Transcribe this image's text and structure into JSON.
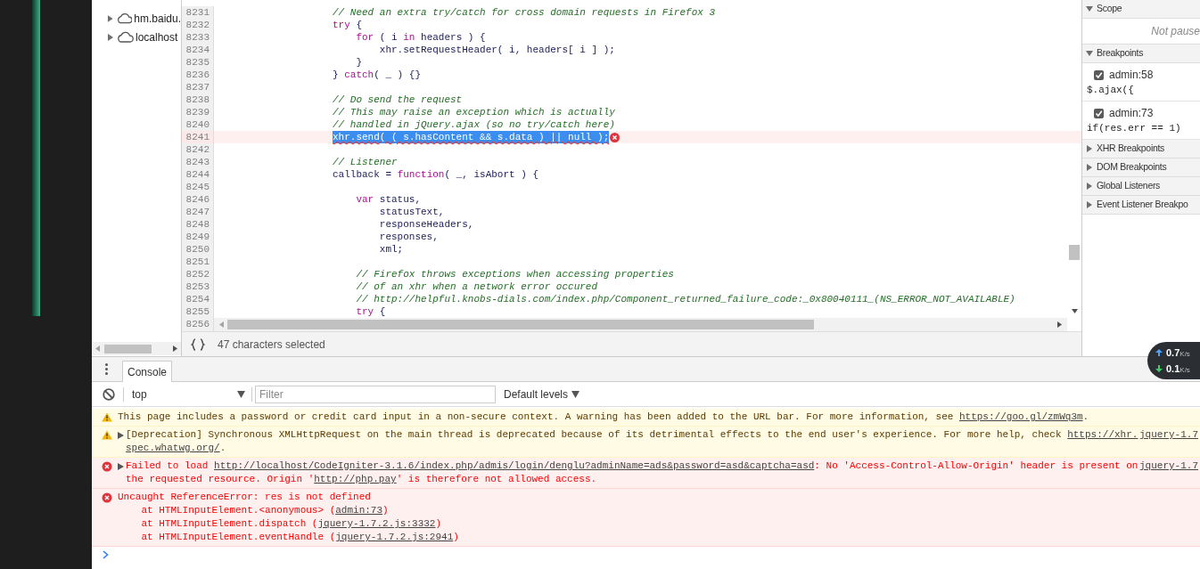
{
  "file_tree": {
    "items": [
      {
        "label": "hm.baidu.",
        "expanded": false
      },
      {
        "label": "localhost",
        "expanded": false
      }
    ]
  },
  "editor": {
    "lines": [
      {
        "number": "8231",
        "error": false,
        "selected": false,
        "segments": [
          {
            "kind": "comment",
            "text": "// Need an extra try/catch for cross domain requests in Firefox 3"
          }
        ]
      },
      {
        "number": "8232",
        "error": false,
        "selected": false,
        "segments": [
          {
            "kind": "keyword",
            "text": "try"
          },
          {
            "kind": "plain",
            "text": " {"
          }
        ]
      },
      {
        "number": "8233",
        "error": false,
        "selected": false,
        "segments": [
          {
            "kind": "keyword",
            "text": "    for"
          },
          {
            "kind": "plain",
            "text": " ( i "
          },
          {
            "kind": "keyword",
            "text": "in"
          },
          {
            "kind": "plain",
            "text": " headers ) {"
          }
        ]
      },
      {
        "number": "8234",
        "error": false,
        "selected": false,
        "segments": [
          {
            "kind": "plain",
            "text": "        xhr.setRequestHeader( i, headers[ i ] );"
          }
        ]
      },
      {
        "number": "8235",
        "error": false,
        "selected": false,
        "segments": [
          {
            "kind": "plain",
            "text": "    }"
          }
        ]
      },
      {
        "number": "8236",
        "error": false,
        "selected": false,
        "segments": [
          {
            "kind": "plain",
            "text": "} "
          },
          {
            "kind": "keyword",
            "text": "catch"
          },
          {
            "kind": "plain",
            "text": "( _ ) {}"
          }
        ]
      },
      {
        "number": "8237",
        "error": false,
        "selected": false
      },
      {
        "number": "8238",
        "error": false,
        "selected": false,
        "segments": [
          {
            "kind": "comment",
            "text": "// Do send the request"
          }
        ]
      },
      {
        "number": "8239",
        "error": false,
        "selected": false,
        "segments": [
          {
            "kind": "comment",
            "text": "// This may raise an exception which is actually"
          }
        ]
      },
      {
        "number": "8240",
        "error": false,
        "selected": false,
        "segments": [
          {
            "kind": "comment",
            "text": "// handled in jQuery.ajax (so no try/catch here)"
          }
        ]
      },
      {
        "number": "8241",
        "error": true,
        "selected": true,
        "segments": [
          {
            "text": "xhr.send( ( s.hasContent && s.data ) || null );"
          }
        ]
      },
      {
        "number": "8242",
        "error": false,
        "selected": false
      },
      {
        "number": "8243",
        "error": false,
        "selected": false,
        "segments": [
          {
            "kind": "comment",
            "text": "// Listener"
          }
        ]
      },
      {
        "number": "8244",
        "error": false,
        "selected": false,
        "segments": [
          {
            "kind": "plain",
            "text": "callback = "
          },
          {
            "kind": "keyword",
            "text": "function"
          },
          {
            "kind": "plain",
            "text": "( _, isAbort ) {"
          }
        ]
      },
      {
        "number": "8245",
        "error": false,
        "selected": false
      },
      {
        "number": "8246",
        "error": false,
        "selected": false,
        "segments": [
          {
            "kind": "keyword",
            "text": "    var"
          },
          {
            "kind": "plain",
            "text": " status,"
          }
        ]
      },
      {
        "number": "8247",
        "error": false,
        "selected": false,
        "segments": [
          {
            "kind": "plain",
            "text": "        statusText,"
          }
        ]
      },
      {
        "number": "8248",
        "error": false,
        "selected": false,
        "segments": [
          {
            "kind": "plain",
            "text": "        responseHeaders,"
          }
        ]
      },
      {
        "number": "8249",
        "error": false,
        "selected": false,
        "segments": [
          {
            "kind": "plain",
            "text": "        responses,"
          }
        ]
      },
      {
        "number": "8250",
        "error": false,
        "selected": false,
        "segments": [
          {
            "kind": "plain",
            "text": "        xml;"
          }
        ]
      },
      {
        "number": "8251",
        "error": false,
        "selected": false
      },
      {
        "number": "8252",
        "error": false,
        "selected": false,
        "segments": [
          {
            "kind": "comment",
            "text": "    // Firefox throws exceptions when accessing properties"
          }
        ]
      },
      {
        "number": "8253",
        "error": false,
        "selected": false,
        "segments": [
          {
            "kind": "comment",
            "text": "    // of an xhr when a network error occured"
          }
        ]
      },
      {
        "number": "8254",
        "error": false,
        "selected": false,
        "segments": [
          {
            "kind": "comment",
            "text": "    // http://helpful.knobs-dials.com/index.php/Component_returned_failure_code:_0x80040111_(NS_ERROR_NOT_AVAILABLE)"
          }
        ]
      },
      {
        "number": "8255",
        "error": false,
        "selected": false,
        "segments": [
          {
            "kind": "keyword",
            "text": "    try"
          },
          {
            "kind": "plain",
            "text": " {"
          }
        ]
      }
    ],
    "last_line_number": "8256",
    "status": "47 characters selected"
  },
  "sidebar": {
    "sections": [
      {
        "kind": "scope",
        "title": "Scope",
        "expanded": true,
        "message": "Not pause"
      },
      {
        "kind": "breakpoints",
        "title": "Breakpoints",
        "expanded": true,
        "items": [
          {
            "location": "admin:58",
            "code": "$.ajax({",
            "checked": true
          },
          {
            "location": "admin:73",
            "code": "if(res.err == 1)",
            "checked": true
          }
        ]
      },
      {
        "title": "XHR Breakpoints",
        "expanded": false
      },
      {
        "title": "DOM Breakpoints",
        "expanded": false
      },
      {
        "title": "Global Listeners",
        "expanded": false
      },
      {
        "title": "Event Listener Breakpo",
        "expanded": false
      }
    ]
  },
  "network_widget": {
    "upload": "0.7",
    "upload_unit": "K/s",
    "download": "0.1",
    "download_unit": "K/s"
  },
  "console": {
    "tabs": [
      {
        "label": "Console",
        "selected": true
      }
    ],
    "context": "top",
    "filter_placeholder": "Filter",
    "levels": "Default levels",
    "messages": [
      {
        "kind": "warning",
        "expandable": false,
        "lines": [
          [
            {
              "text": "This page includes a password or credit card input in a non-secure context. A warning has been added to the URL bar. For more information, see "
            },
            {
              "text": "https://goo.gl/zmWq3m",
              "link": true
            },
            {
              "text": "."
            }
          ]
        ]
      },
      {
        "kind": "warning",
        "expandable": true,
        "source": "jquery-1.7",
        "lines": [
          [
            {
              "text": "[Deprecation] Synchronous XMLHttpRequest on the main thread is deprecated because of its detrimental effects to the end user's experience. For more help, check "
            },
            {
              "text": "https://xhr.",
              "link": true
            }
          ],
          [
            {
              "text": "spec.whatwg.org/",
              "link": true
            },
            {
              "text": "."
            }
          ]
        ]
      },
      {
        "kind": "error",
        "expandable": true,
        "source": "jquery-1.7",
        "lines": [
          [
            {
              "text": "Failed to load "
            },
            {
              "text": "http://localhost/CodeIgniter-3.1.6/index.php/admis/login/denglu?adminName=ads&password=asd&captcha=asd",
              "link": true
            },
            {
              "text": ": No 'Access-Control-Allow-Origin' header is present on"
            }
          ],
          [
            {
              "text": "the requested resource. Origin '"
            },
            {
              "text": "http://php.pay",
              "link": true
            },
            {
              "text": "' is therefore not allowed access."
            }
          ]
        ]
      },
      {
        "kind": "error",
        "expandable": false,
        "lines": [
          [
            {
              "text": "Uncaught ReferenceError: res is not defined"
            }
          ],
          [
            {
              "text": "    at HTMLInputElement.<anonymous> ("
            },
            {
              "text": "admin:73",
              "link": true
            },
            {
              "text": ")"
            }
          ],
          [
            {
              "text": "    at HTMLInputElement.dispatch ("
            },
            {
              "text": "jquery-1.7.2.js:3332",
              "link": true
            },
            {
              "text": ")"
            }
          ],
          [
            {
              "text": "    at HTMLInputElement.eventHandle ("
            },
            {
              "text": "jquery-1.7.2.js:2941",
              "link": true
            },
            {
              "text": ")"
            }
          ]
        ]
      }
    ]
  }
}
